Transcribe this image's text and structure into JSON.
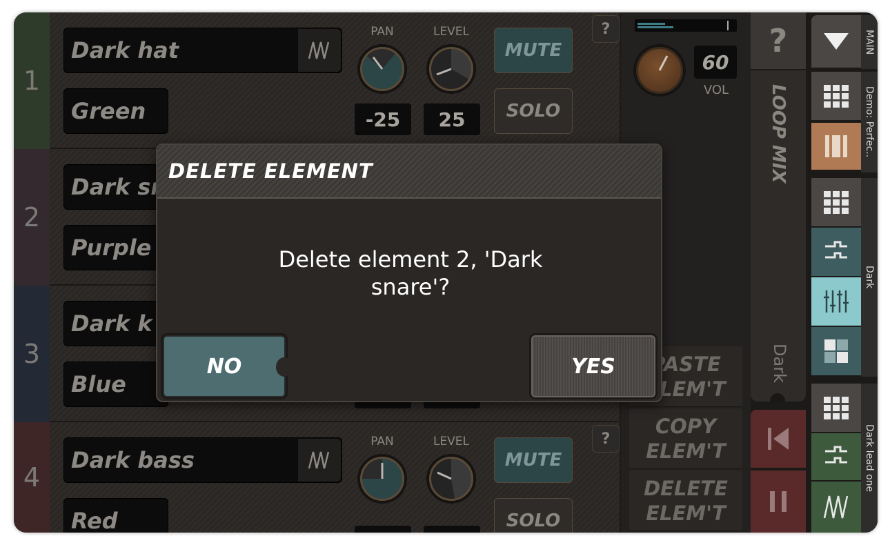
{
  "elements": [
    {
      "number": "1",
      "name": "Dark  hat",
      "color_name": "Green",
      "strip_color": "#2e3b2a",
      "pan_label": "PAN",
      "level_label": "LEVEL",
      "pan": "-25",
      "level": "25",
      "mute": "MUTE",
      "solo": "SOLO",
      "help": "?"
    },
    {
      "number": "2",
      "name": "Dark  sn",
      "color_name": "Purple",
      "strip_color": "#33292f"
    },
    {
      "number": "3",
      "name": "Dark  k",
      "color_name": "Blue",
      "strip_color": "#232a36"
    },
    {
      "number": "4",
      "name": "Dark  bass",
      "color_name": "Red",
      "strip_color": "#3f2626",
      "pan_label": "PAN",
      "level_label": "LEVEL",
      "pan": "0",
      "level": "50",
      "mute": "MUTE",
      "solo": "SOLO",
      "help": "?"
    }
  ],
  "mix": {
    "volume": "60",
    "volume_label": "VOL",
    "help": "?",
    "loop_mix": "LOOP MIX",
    "current": "Dark"
  },
  "actions": {
    "paste": "PASTE ELEM'T",
    "copy": "COPY ELEM'T",
    "delete": "DELETE ELEM'T"
  },
  "rightbar": {
    "labels": [
      "MAIN",
      "Demo: Perfec..",
      "Dark",
      "Dark lead one"
    ],
    "icons": [
      "menu-down-icon",
      "grid-icon",
      "song-icon",
      "grid-icon",
      "sequencer-icon",
      "mixer-icon",
      "pattern-icon",
      "grid-icon",
      "sequencer-icon",
      "waveform-icon"
    ]
  },
  "dialog": {
    "title": "DELETE  ELEMENT",
    "message_line1": "Delete element 2, 'Dark",
    "message_line2": "snare'?",
    "no": "NO",
    "yes": "YES"
  },
  "colors": {
    "accent_teal": "#3e5d60",
    "accent_orange": "#b07a55",
    "mixer_active": "#8cc9cc",
    "green_dark": "#3e5a3d",
    "transport_red": "#5a2a2a"
  }
}
